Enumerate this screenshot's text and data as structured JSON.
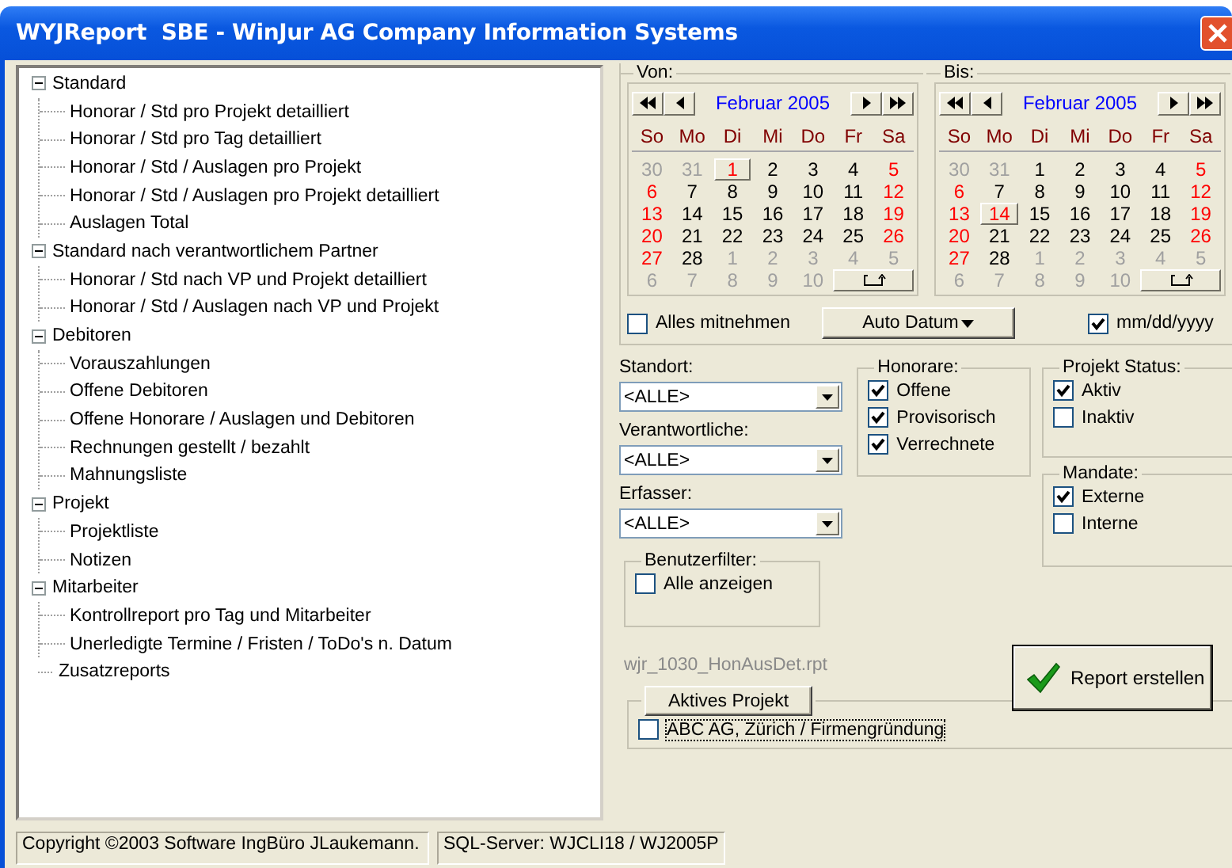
{
  "window": {
    "title": "WYJReport  SBE - WinJur AG Company Information Systems"
  },
  "report_tree": [
    {
      "label": "Standard",
      "expanded": true,
      "children": [
        {
          "label": "Honorar / Std pro Projekt detailliert"
        },
        {
          "label": "Honorar / Std pro Tag detailliert"
        },
        {
          "label": "Honorar / Std / Auslagen pro Projekt"
        },
        {
          "label": "Honorar / Std / Auslagen pro Projekt detailliert"
        },
        {
          "label": "Auslagen Total"
        }
      ]
    },
    {
      "label": "Standard nach verantwortlichem Partner",
      "expanded": true,
      "children": [
        {
          "label": "Honorar / Std nach VP und Projekt detailliert"
        },
        {
          "label": "Honorar / Std / Auslagen nach VP und Projekt"
        }
      ]
    },
    {
      "label": "Debitoren",
      "expanded": true,
      "children": [
        {
          "label": "Vorauszahlungen"
        },
        {
          "label": "Offene Debitoren"
        },
        {
          "label": "Offene Honorare / Auslagen und Debitoren"
        },
        {
          "label": "Rechnungen gestellt / bezahlt"
        },
        {
          "label": "Mahnungsliste"
        }
      ]
    },
    {
      "label": "Projekt",
      "expanded": true,
      "children": [
        {
          "label": "Projektliste"
        },
        {
          "label": "Notizen"
        }
      ]
    },
    {
      "label": "Mitarbeiter",
      "expanded": true,
      "children": [
        {
          "label": "Kontrollreport pro Tag und Mitarbeiter"
        },
        {
          "label": "Unerledigte Termine / Fristen / ToDo's n. Datum"
        }
      ]
    },
    {
      "label": "Zusatzreports"
    }
  ],
  "calendars": [
    {
      "legend": "Von:",
      "month": "Februar 2005",
      "weekdays": [
        "So",
        "Mo",
        "Di",
        "Mi",
        "Do",
        "Fr",
        "Sa"
      ],
      "days": [
        {
          "d": "30",
          "kind": "other",
          "selected": false
        },
        {
          "d": "31",
          "kind": "other",
          "selected": false
        },
        {
          "d": "1",
          "kind": "weekday",
          "selected": true
        },
        {
          "d": "2",
          "kind": "weekday",
          "selected": false
        },
        {
          "d": "3",
          "kind": "weekday",
          "selected": false
        },
        {
          "d": "4",
          "kind": "weekday",
          "selected": false
        },
        {
          "d": "5",
          "kind": "weekend",
          "selected": false
        },
        {
          "d": "6",
          "kind": "weekend",
          "selected": false
        },
        {
          "d": "7",
          "kind": "weekday",
          "selected": false
        },
        {
          "d": "8",
          "kind": "weekday",
          "selected": false
        },
        {
          "d": "9",
          "kind": "weekday",
          "selected": false
        },
        {
          "d": "10",
          "kind": "weekday",
          "selected": false
        },
        {
          "d": "11",
          "kind": "weekday",
          "selected": false
        },
        {
          "d": "12",
          "kind": "weekend",
          "selected": false
        },
        {
          "d": "13",
          "kind": "weekend",
          "selected": false
        },
        {
          "d": "14",
          "kind": "weekday",
          "selected": false
        },
        {
          "d": "15",
          "kind": "weekday",
          "selected": false
        },
        {
          "d": "16",
          "kind": "weekday",
          "selected": false
        },
        {
          "d": "17",
          "kind": "weekday",
          "selected": false
        },
        {
          "d": "18",
          "kind": "weekday",
          "selected": false
        },
        {
          "d": "19",
          "kind": "weekend",
          "selected": false
        },
        {
          "d": "20",
          "kind": "weekend",
          "selected": false
        },
        {
          "d": "21",
          "kind": "weekday",
          "selected": false
        },
        {
          "d": "22",
          "kind": "weekday",
          "selected": false
        },
        {
          "d": "23",
          "kind": "weekday",
          "selected": false
        },
        {
          "d": "24",
          "kind": "weekday",
          "selected": false
        },
        {
          "d": "25",
          "kind": "weekday",
          "selected": false
        },
        {
          "d": "26",
          "kind": "weekend",
          "selected": false
        },
        {
          "d": "27",
          "kind": "weekend",
          "selected": false
        },
        {
          "d": "28",
          "kind": "weekday",
          "selected": false
        },
        {
          "d": "1",
          "kind": "other",
          "selected": false
        },
        {
          "d": "2",
          "kind": "other",
          "selected": false
        },
        {
          "d": "3",
          "kind": "other",
          "selected": false
        },
        {
          "d": "4",
          "kind": "other",
          "selected": false
        },
        {
          "d": "5",
          "kind": "other",
          "selected": false
        },
        {
          "d": "6",
          "kind": "other",
          "selected": false
        },
        {
          "d": "7",
          "kind": "other",
          "selected": false
        },
        {
          "d": "8",
          "kind": "other",
          "selected": false
        },
        {
          "d": "9",
          "kind": "other",
          "selected": false
        },
        {
          "d": "10",
          "kind": "other",
          "selected": false
        }
      ]
    },
    {
      "legend": "Bis:",
      "month": "Februar 2005",
      "weekdays": [
        "So",
        "Mo",
        "Di",
        "Mi",
        "Do",
        "Fr",
        "Sa"
      ],
      "days": [
        {
          "d": "30",
          "kind": "other",
          "selected": false
        },
        {
          "d": "31",
          "kind": "other",
          "selected": false
        },
        {
          "d": "1",
          "kind": "weekday",
          "selected": false
        },
        {
          "d": "2",
          "kind": "weekday",
          "selected": false
        },
        {
          "d": "3",
          "kind": "weekday",
          "selected": false
        },
        {
          "d": "4",
          "kind": "weekday",
          "selected": false
        },
        {
          "d": "5",
          "kind": "weekend",
          "selected": false
        },
        {
          "d": "6",
          "kind": "weekend",
          "selected": false
        },
        {
          "d": "7",
          "kind": "weekday",
          "selected": false
        },
        {
          "d": "8",
          "kind": "weekday",
          "selected": false
        },
        {
          "d": "9",
          "kind": "weekday",
          "selected": false
        },
        {
          "d": "10",
          "kind": "weekday",
          "selected": false
        },
        {
          "d": "11",
          "kind": "weekday",
          "selected": false
        },
        {
          "d": "12",
          "kind": "weekend",
          "selected": false
        },
        {
          "d": "13",
          "kind": "weekend",
          "selected": false
        },
        {
          "d": "14",
          "kind": "weekday",
          "selected": true
        },
        {
          "d": "15",
          "kind": "weekday",
          "selected": false
        },
        {
          "d": "16",
          "kind": "weekday",
          "selected": false
        },
        {
          "d": "17",
          "kind": "weekday",
          "selected": false
        },
        {
          "d": "18",
          "kind": "weekday",
          "selected": false
        },
        {
          "d": "19",
          "kind": "weekend",
          "selected": false
        },
        {
          "d": "20",
          "kind": "weekend",
          "selected": false
        },
        {
          "d": "21",
          "kind": "weekday",
          "selected": false
        },
        {
          "d": "22",
          "kind": "weekday",
          "selected": false
        },
        {
          "d": "23",
          "kind": "weekday",
          "selected": false
        },
        {
          "d": "24",
          "kind": "weekday",
          "selected": false
        },
        {
          "d": "25",
          "kind": "weekday",
          "selected": false
        },
        {
          "d": "26",
          "kind": "weekend",
          "selected": false
        },
        {
          "d": "27",
          "kind": "weekend",
          "selected": false
        },
        {
          "d": "28",
          "kind": "weekday",
          "selected": false
        },
        {
          "d": "1",
          "kind": "other",
          "selected": false
        },
        {
          "d": "2",
          "kind": "other",
          "selected": false
        },
        {
          "d": "3",
          "kind": "other",
          "selected": false
        },
        {
          "d": "4",
          "kind": "other",
          "selected": false
        },
        {
          "d": "5",
          "kind": "other",
          "selected": false
        },
        {
          "d": "6",
          "kind": "other",
          "selected": false
        },
        {
          "d": "7",
          "kind": "other",
          "selected": false
        },
        {
          "d": "8",
          "kind": "other",
          "selected": false
        },
        {
          "d": "9",
          "kind": "other",
          "selected": false
        },
        {
          "d": "10",
          "kind": "other",
          "selected": false
        }
      ]
    }
  ],
  "alles_mitnehmen": {
    "label": "Alles mitnehmen",
    "checked": false
  },
  "auto_datum_button": "Auto Datum",
  "date_format": {
    "label": "mm/dd/yyyy",
    "checked": true
  },
  "filters": [
    {
      "label": "Standort:",
      "value": "<ALLE>"
    },
    {
      "label": "Verantwortliche:",
      "value": "<ALLE>"
    },
    {
      "label": "Erfasser:",
      "value": "<ALLE>"
    }
  ],
  "benutzerfilter": {
    "legend": "Benutzerfilter:",
    "options": [
      {
        "label": "Alle anzeigen",
        "checked": false
      }
    ]
  },
  "honorare": {
    "legend": "Honorare:",
    "options": [
      {
        "label": "Offene",
        "checked": true
      },
      {
        "label": "Provisorisch",
        "checked": true
      },
      {
        "label": "Verrechnete",
        "checked": true
      }
    ]
  },
  "projekt_status": {
    "legend": "Projekt Status:",
    "options": [
      {
        "label": "Aktiv",
        "checked": true
      },
      {
        "label": "Inaktiv",
        "checked": false
      }
    ]
  },
  "mandate": {
    "legend": "Mandate:",
    "options": [
      {
        "label": "Externe",
        "checked": true
      },
      {
        "label": "Interne",
        "checked": false
      }
    ]
  },
  "report_file": "wjr_1030_HonAusDet.rpt",
  "report_button": "Report erstellen",
  "aktives_projekt": {
    "button": "Aktives Projekt",
    "options": [
      {
        "label": "ABC AG, Zürich / Firmengründung",
        "checked": false
      }
    ]
  },
  "status_bar": [
    "Copyright ©2003 Software IngBüro JLaukemann.",
    "SQL-Server: WJCLI18 / WJ2005P"
  ]
}
